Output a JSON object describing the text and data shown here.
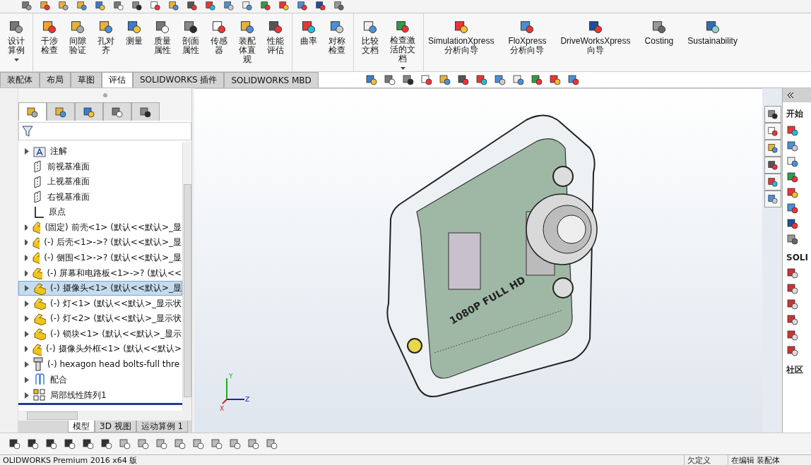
{
  "ribbon": {
    "groups": [
      [
        {
          "label": "设计算例",
          "dropdown": true
        }
      ],
      [
        {
          "label": "干涉检查",
          "dropdown": false
        },
        {
          "label": "间隙验证",
          "dropdown": false
        },
        {
          "label": "孔对齐",
          "dropdown": false
        },
        {
          "label": "测量",
          "dropdown": false
        },
        {
          "label": "质量属性",
          "dropdown": false
        },
        {
          "label": "剖面属性",
          "dropdown": false
        },
        {
          "label": "传感器",
          "dropdown": false
        },
        {
          "label": "装配体直观",
          "dropdown": false
        },
        {
          "label": "性能评估",
          "dropdown": false
        }
      ],
      [
        {
          "label": "曲率",
          "dropdown": false
        },
        {
          "label": "对称检查",
          "dropdown": false
        }
      ],
      [
        {
          "label": "比较文档",
          "dropdown": false
        },
        {
          "label": "检查激活的文档",
          "dropdown": true
        }
      ],
      [
        {
          "label": "SimulationXpress\n分析向导",
          "dropdown": false
        },
        {
          "label": "FloXpress\n分析向导",
          "dropdown": false
        },
        {
          "label": "DriveWorksXpress\n向导",
          "dropdown": false
        },
        {
          "label": "Costing",
          "dropdown": false
        },
        {
          "label": "Sustainability",
          "dropdown": false
        }
      ]
    ]
  },
  "tabs": [
    {
      "label": "装配体",
      "selected": false
    },
    {
      "label": "布局",
      "selected": false
    },
    {
      "label": "草图",
      "selected": false
    },
    {
      "label": "评估",
      "selected": true
    },
    {
      "label": "SOLIDWORKS 插件",
      "selected": false
    },
    {
      "label": "SOLIDWORKS MBD",
      "selected": false
    }
  ],
  "feature_manager": {
    "panel_tabs": [
      {
        "selected": true
      },
      {
        "selected": false
      },
      {
        "selected": false
      },
      {
        "selected": false
      },
      {
        "selected": false
      }
    ],
    "tree": [
      {
        "kind": "annotation",
        "label": "注解",
        "expandable": true,
        "selected": false
      },
      {
        "kind": "plane",
        "label": "前视基准面",
        "expandable": false,
        "selected": false
      },
      {
        "kind": "plane",
        "label": "上视基准面",
        "expandable": false,
        "selected": false
      },
      {
        "kind": "plane",
        "label": "右视基准面",
        "expandable": false,
        "selected": false
      },
      {
        "kind": "origin",
        "label": "原点",
        "expandable": false,
        "selected": false
      },
      {
        "kind": "part",
        "label": "(固定) 前壳<1> (默认<<默认>_显",
        "expandable": true,
        "selected": false
      },
      {
        "kind": "part",
        "label": "(-) 后壳<1>->? (默认<<默认>_显",
        "expandable": true,
        "selected": false
      },
      {
        "kind": "part",
        "label": "(-) 侧围<1>->? (默认<<默认>_显",
        "expandable": true,
        "selected": false
      },
      {
        "kind": "part",
        "label": "(-) 屏幕和电路板<1>->? (默认<<",
        "expandable": true,
        "selected": false
      },
      {
        "kind": "part",
        "label": "(-) 摄像头<1> (默认<<默认>_显",
        "expandable": true,
        "selected": true
      },
      {
        "kind": "part",
        "label": "(-) 灯<1> (默认<<默认>_显示状",
        "expandable": true,
        "selected": false
      },
      {
        "kind": "part",
        "label": "(-) 灯<2> (默认<<默认>_显示状",
        "expandable": true,
        "selected": false
      },
      {
        "kind": "part",
        "label": "(-) 锁块<1> (默认<<默认>_显示",
        "expandable": true,
        "selected": false
      },
      {
        "kind": "part",
        "label": "(-) 摄像头外框<1> (默认<<默认>",
        "expandable": true,
        "selected": false
      },
      {
        "kind": "bolt",
        "label": "(-) hexagon head bolts-full thre",
        "expandable": true,
        "selected": false
      },
      {
        "kind": "mates",
        "label": "配合",
        "expandable": true,
        "selected": false
      },
      {
        "kind": "pattern",
        "label": "局部线性阵列1",
        "expandable": true,
        "selected": false
      }
    ],
    "bottom_tabs": [
      {
        "label": "模型",
        "selected": true
      },
      {
        "label": "3D 视图",
        "selected": false
      },
      {
        "label": "运动算例 1",
        "selected": false
      }
    ]
  },
  "viewport": {
    "model_label": "1080P FULL HD",
    "triad": [
      "Y",
      "Z",
      "X"
    ]
  },
  "task_pane": {
    "sections": [
      "开始",
      "SOLI",
      "社区"
    ]
  },
  "status_bar": {
    "left": "OLIDWORKS Premium 2016 x64 版",
    "right": [
      "欠定义",
      "在编辑 装配体"
    ]
  }
}
